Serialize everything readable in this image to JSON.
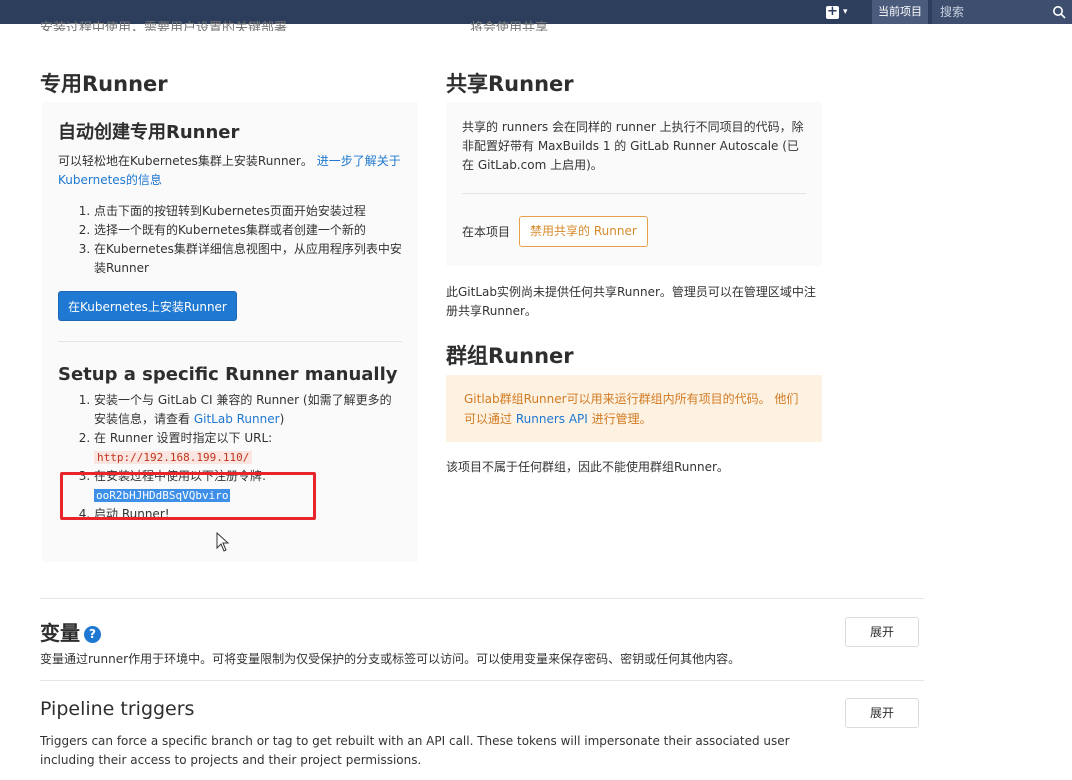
{
  "topbar": {
    "scope_label": "当前项目",
    "search_placeholder": "搜索"
  },
  "cut_text": {
    "left": "安装过程中使用，需要用户设置的关键部署",
    "right": "将会使用共享"
  },
  "specific": {
    "title": "专用Runner",
    "auto": {
      "title": "自动创建专用Runner",
      "desc": "可以轻松地在Kubernetes集群上安装Runner。",
      "link": "进一步了解关于Kubernetes的信息",
      "steps": [
        "点击下面的按钮转到Kubernetes页面开始安装过程",
        "选择一个既有的Kubernetes集群或者创建一个新的",
        "在Kubernetes集群详细信息视图中，从应用程序列表中安装Runner"
      ],
      "install_button": "在Kubernetes上安装Runner"
    },
    "manual": {
      "title": "Setup a specific Runner manually",
      "step1_text": "安装一个与 GitLab CI 兼容的 Runner (如需了解更多的安装信息，请查看 ",
      "step1_link": "GitLab Runner",
      "step1_end": ")",
      "step2_text": "在 Runner 设置时指定以下 URL:",
      "url": "http://192.168.199.110/",
      "step3_text": "在安装过程中使用以下注册令牌:",
      "token": "ooR2bHJHDdBSqVQbviro",
      "step4_text": "启动 Runner!"
    }
  },
  "shared": {
    "title": "共享Runner",
    "desc": "共享的 runners 会在同样的 runner 上执行不同项目的代码，除非配置好带有 MaxBuilds 1 的 GitLab Runner Autoscale (已在 GitLab.com 上启用)。",
    "project_label": "在本项目",
    "disable_button": "禁用共享的 Runner",
    "none_note": "此GitLab实例尚未提供任何共享Runner。管理员可以在管理区域中注册共享Runner。"
  },
  "group": {
    "title": "群组Runner",
    "warn_text": "Gitlab群组Runner可以用来运行群组内所有项目的代码。 他们可以通过 ",
    "warn_link": "Runners API",
    "warn_end": " 进行管理。",
    "note": "该项目不属于任何群组，因此不能使用群组Runner。"
  },
  "variables": {
    "title": "变量",
    "help": "?",
    "desc": "变量通过runner作用于环境中。可将变量限制为仅受保护的分支或标签可以访问。可以使用变量来保存密码、密钥或任何其他内容。",
    "expand": "展开"
  },
  "triggers": {
    "title": "Pipeline triggers",
    "desc": "Triggers can force a specific branch or tag to get rebuilt with an API call. These tokens will impersonate their associated user including their access to projects and their project permissions.",
    "expand": "展开"
  }
}
